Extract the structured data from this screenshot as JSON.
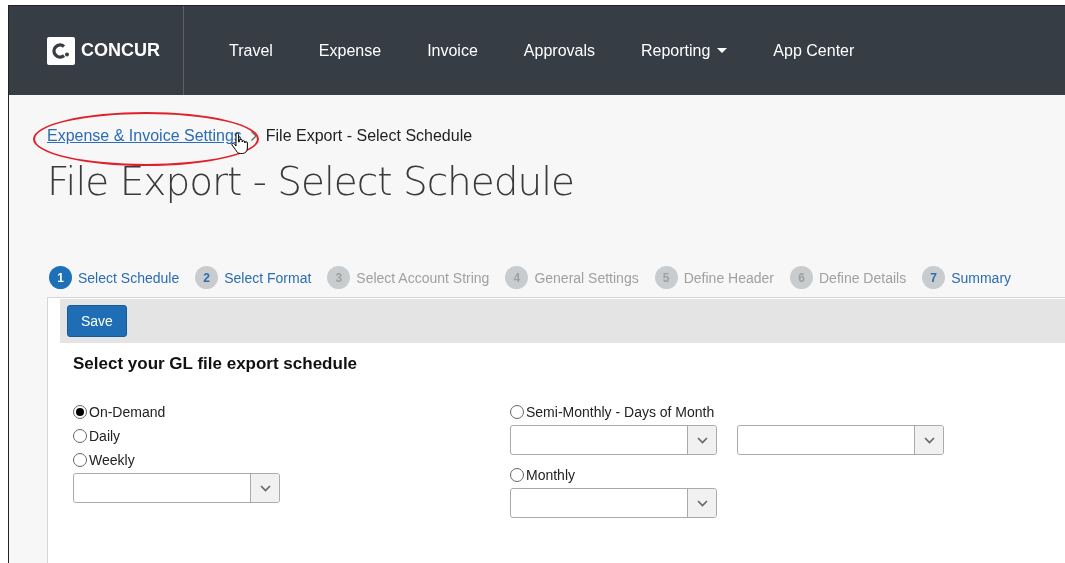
{
  "nav": {
    "logo": "CONCUR",
    "items": [
      {
        "label": "Travel",
        "dropdown": false
      },
      {
        "label": "Expense",
        "dropdown": false
      },
      {
        "label": "Invoice",
        "dropdown": false
      },
      {
        "label": "Approvals",
        "dropdown": false
      },
      {
        "label": "Reporting",
        "dropdown": true
      },
      {
        "label": "App Center",
        "dropdown": false
      }
    ]
  },
  "breadcrumb": {
    "link": "Expense & Invoice Settings",
    "current": "File Export - Select Schedule",
    "highlighted": true
  },
  "title": "File Export - Select Schedule",
  "steps": [
    {
      "number": "1",
      "label": "Select Schedule",
      "selected": true,
      "disabled": false
    },
    {
      "number": "2",
      "label": "Select Format",
      "selected": false,
      "disabled": false
    },
    {
      "number": "3",
      "label": "Select Account String",
      "selected": false,
      "disabled": true
    },
    {
      "number": "4",
      "label": "General Settings",
      "selected": false,
      "disabled": true
    },
    {
      "number": "5",
      "label": "Define Header",
      "selected": false,
      "disabled": true
    },
    {
      "number": "6",
      "label": "Define Details",
      "selected": false,
      "disabled": true
    },
    {
      "number": "7",
      "label": "Summary",
      "selected": false,
      "disabled": false
    }
  ],
  "save_button": "Save",
  "form": {
    "heading": "Select your GL file export schedule",
    "left": [
      {
        "label": "On-Demand",
        "selected": true,
        "kind": "plain"
      },
      {
        "label": "Daily",
        "selected": false,
        "kind": "plain"
      },
      {
        "label": "Weekly",
        "selected": false,
        "kind": "single-dropdown"
      }
    ],
    "right": [
      {
        "label": "Semi-Monthly - Days of Month",
        "selected": false,
        "kind": "double-dropdown"
      },
      {
        "label": "Monthly",
        "selected": false,
        "kind": "single-dropdown"
      }
    ]
  }
}
